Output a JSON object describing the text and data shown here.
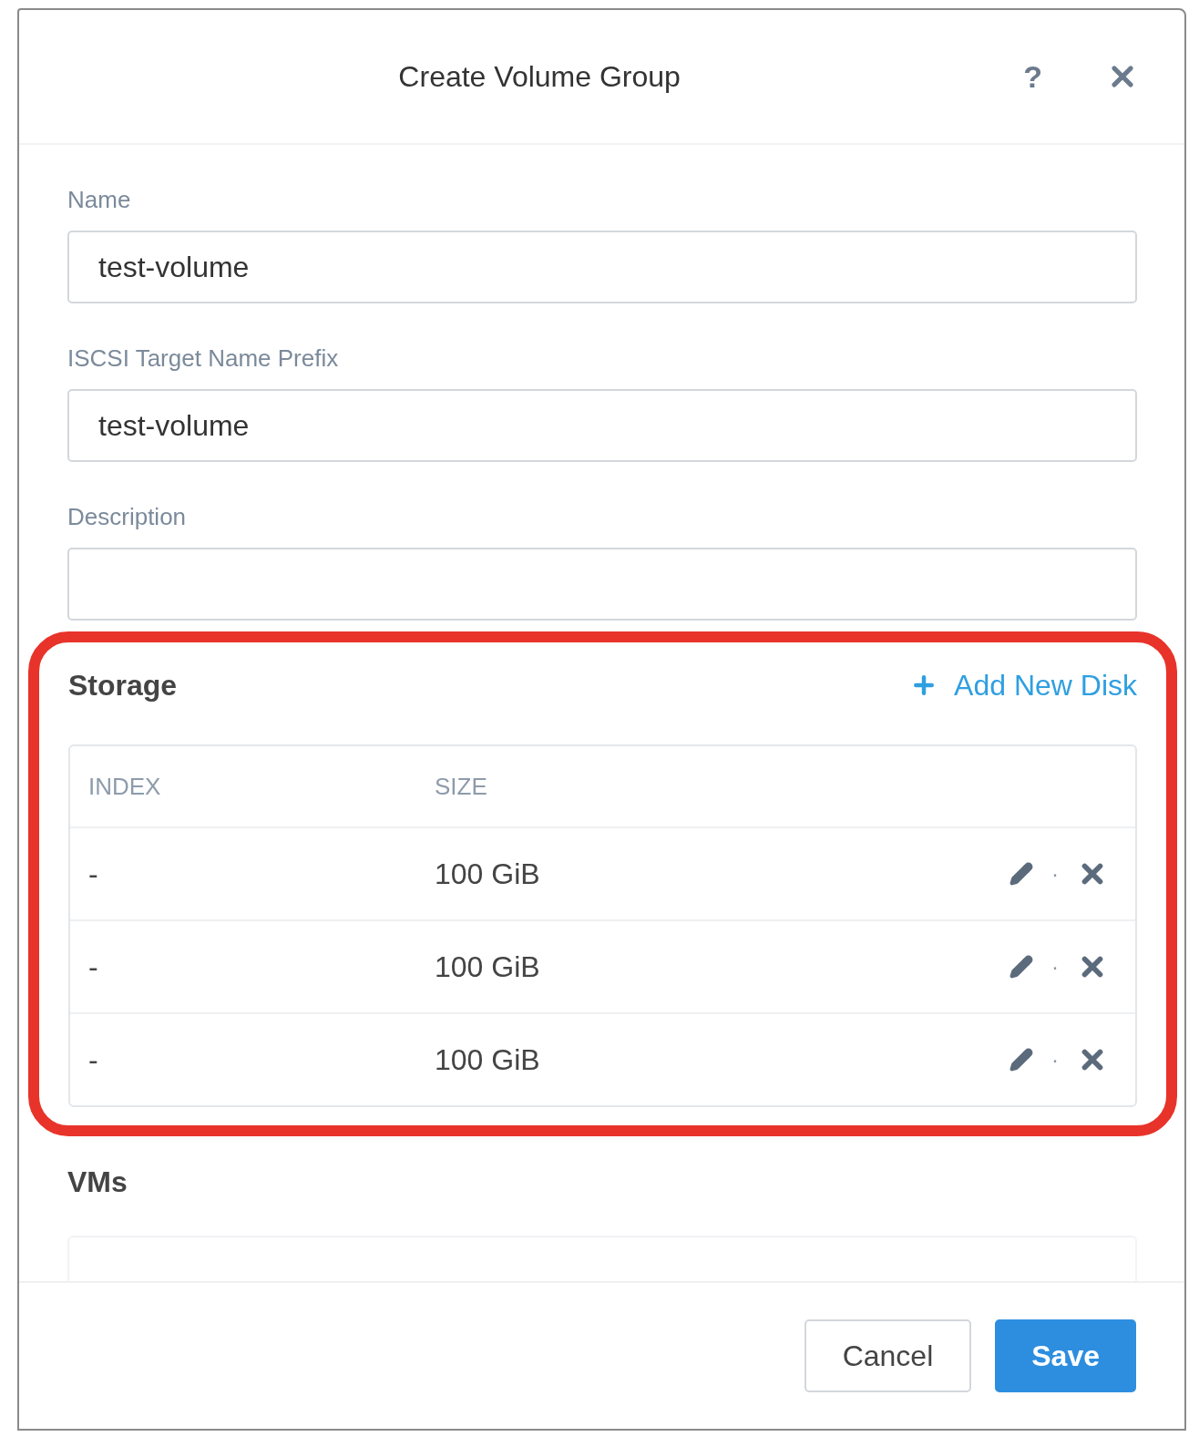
{
  "dialog": {
    "title": "Create Volume Group",
    "help": "?"
  },
  "fields": [
    {
      "label": "Name",
      "value": "test-volume"
    },
    {
      "label": "ISCSI Target Name Prefix",
      "value": "test-volume"
    },
    {
      "label": "Description"
    }
  ],
  "storage": {
    "title": "Storage",
    "add_label": "Add New Disk",
    "columns": [
      "INDEX",
      "SIZE"
    ],
    "rows": [
      {
        "index": "-",
        "size": "100 GiB",
        "separator": "·"
      },
      {
        "index": "-",
        "size": "100 GiB",
        "separator": "·"
      },
      {
        "index": "-",
        "size": "100 GiB",
        "separator": "·"
      }
    ]
  },
  "vms": {
    "title": "VMs"
  },
  "buttons": [
    {
      "label": "Cancel",
      "kind": "secondary"
    },
    {
      "label": "Save",
      "kind": "primary"
    }
  ]
}
